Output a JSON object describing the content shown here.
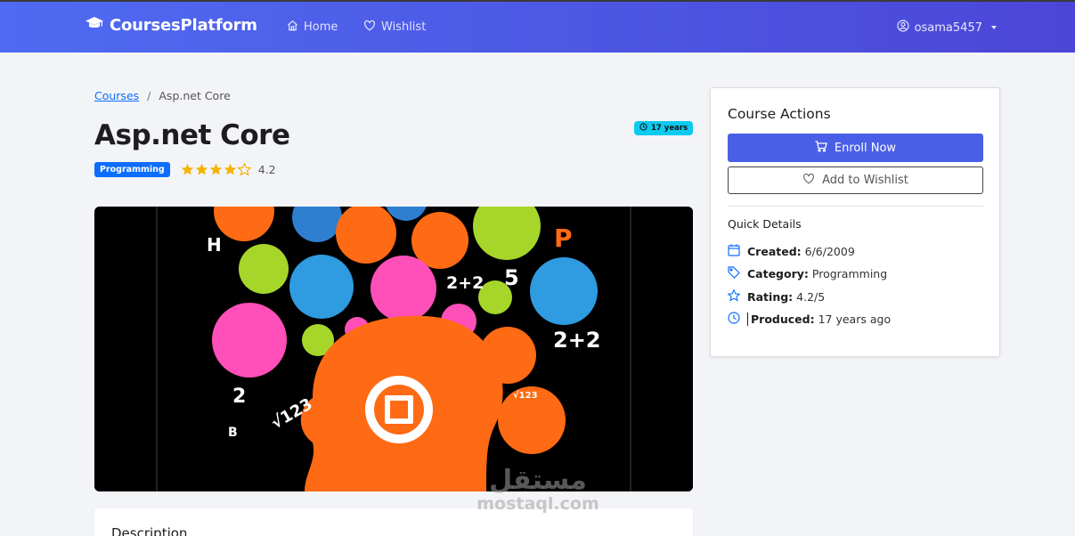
{
  "navbar": {
    "brand": "CoursesPlatform",
    "links": [
      {
        "label": "Home",
        "icon": "home-icon"
      },
      {
        "label": "Wishlist",
        "icon": "heart-icon"
      }
    ],
    "user": {
      "name": "osama5457",
      "icon": "user-circle-icon"
    }
  },
  "breadcrumb": {
    "parent": "Courses",
    "current": "Asp.net Core"
  },
  "course": {
    "title": "Asp.net Core",
    "age_badge": "17 years",
    "category_badge": "Programming",
    "rating": 4.2,
    "rating_text": "4.2",
    "stars_max": 5
  },
  "description": {
    "title": "Description"
  },
  "sidebar": {
    "title": "Course Actions",
    "enroll_label": "Enroll Now",
    "wishlist_label": "Add to Wishlist",
    "quick_details_title": "Quick Details",
    "details": [
      {
        "label": "Created:",
        "value": "6/6/2009",
        "icon": "calendar-icon"
      },
      {
        "label": "Category:",
        "value": "Programming",
        "icon": "tag-icon"
      },
      {
        "label": "Rating:",
        "value": "4.2/5",
        "icon": "star-icon"
      },
      {
        "label": "Produced:",
        "value": "17 years ago",
        "icon": "clock-icon"
      }
    ]
  },
  "watermark": {
    "arabic": "مستقل",
    "latin": "mostaql.com"
  },
  "colors": {
    "primary": "#4a5fe8",
    "badge_cyan": "#0dcaf0",
    "badge_blue": "#0d6efd",
    "star": "#f5b301",
    "page_bg": "#f3f4f8"
  }
}
